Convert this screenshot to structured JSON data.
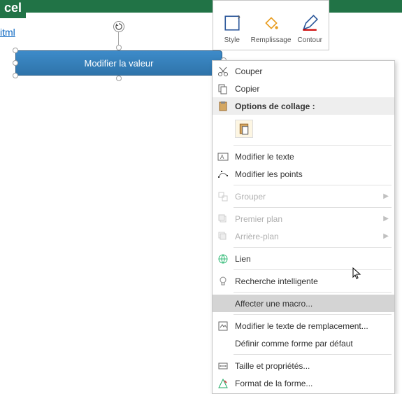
{
  "title_fragment": "cel",
  "link_fragment": "itml",
  "mini_toolbar": {
    "style": "Style",
    "fill": "Remplissage",
    "outline": "Contour"
  },
  "shape_button": {
    "label": "Modifier la valeur"
  },
  "context_menu": {
    "cut": "Couper",
    "copy": "Copier",
    "paste_options": "Options de collage :",
    "edit_text": "Modifier le texte",
    "edit_points": "Modifier les points",
    "group": "Grouper",
    "bring_forward": "Premier plan",
    "send_backward": "Arrière-plan",
    "link": "Lien",
    "smart_lookup": "Recherche intelligente",
    "assign_macro": "Affecter une macro...",
    "alt_text": "Modifier le texte de remplacement...",
    "set_default": "Définir comme forme par défaut",
    "size_props": "Taille et propriétés...",
    "format_shape": "Format de la forme..."
  }
}
